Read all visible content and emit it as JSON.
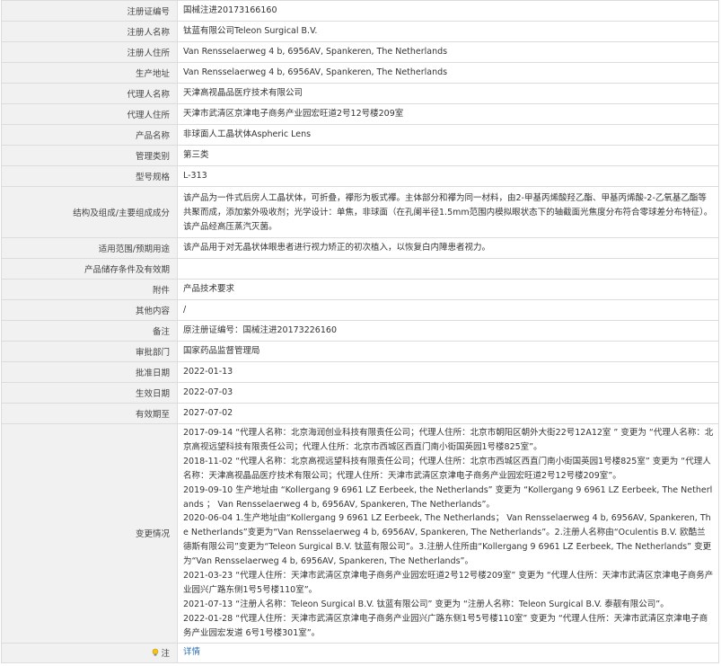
{
  "rows": [
    {
      "label": "注册证编号",
      "value": "国械注进20173166160"
    },
    {
      "label": "注册人名称",
      "value": "钛蓝有限公司Teleon Surgical B.V."
    },
    {
      "label": "注册人住所",
      "value": "Van Rensselaerweg 4 b, 6956AV, Spankeren, The Netherlands"
    },
    {
      "label": "生产地址",
      "value": "Van Rensselaerweg 4 b, 6956AV, Spankeren, The Netherlands"
    },
    {
      "label": "代理人名称",
      "value": "天津高视晶品医疗技术有限公司"
    },
    {
      "label": "代理人住所",
      "value": "天津市武清区京津电子商务产业园宏旺道2号12号楼209室"
    },
    {
      "label": "产品名称",
      "value": "非球面人工晶状体Aspheric Lens"
    },
    {
      "label": "管理类别",
      "value": "第三类"
    },
    {
      "label": "型号规格",
      "value": "L-313"
    },
    {
      "label": "结构及组成/主要组成成分",
      "value": "该产品为一件式后房人工晶状体，可折叠，襻形为板式襻。主体部分和襻为同一材料，由2-甲基丙烯酸羟乙酯、甲基丙烯酸-2-乙氧基乙酯等共聚而成，添加紫外吸收剂；光学设计：单焦，非球面（在孔阑半径1.5mm范围内模拟眼状态下的轴截面光焦度分布符合零球差分布特征）。该产品经高压蒸汽灭菌。"
    },
    {
      "label": "适用范围/预期用途",
      "value": "该产品用于对无晶状体眼患者进行视力矫正的初次植入，以恢复白内障患者视力。"
    },
    {
      "label": "产品储存条件及有效期",
      "value": ""
    },
    {
      "label": "附件",
      "value": "产品技术要求"
    },
    {
      "label": "其他内容",
      "value": "/"
    },
    {
      "label": "备注",
      "value": "原注册证编号：国械注进20173226160"
    },
    {
      "label": "审批部门",
      "value": "国家药品监督管理局"
    },
    {
      "label": "批准日期",
      "value": "2022-01-13"
    },
    {
      "label": "生效日期",
      "value": "2022-07-03"
    },
    {
      "label": "有效期至",
      "value": "2027-07-02"
    }
  ],
  "changes": {
    "label": "变更情况",
    "lines": [
      "2017-09-14 “代理人名称：北京海润创业科技有限责任公司；代理人住所：北京市朝阳区朝外大街22号12A12室 ” 变更为 “代理人名称：北京高视远望科技有限责任公司；代理人住所：北京市西城区西直门南小街国英园1号楼825室”。",
      "2018-11-02 “代理人名称：北京高视远望科技有限责任公司；代理人住所：北京市西城区西直门南小街国英园1号楼825室” 变更为 “代理人名称：天津高视晶品医疗技术有限公司；代理人住所：天津市武清区京津电子商务产业园宏旺道2号12号楼209室”。",
      "2019-09-10 生产地址由 “Kollergang 9 6961 LZ Eerbeek, the Netherlands” 变更为 “Kollergang 9 6961 LZ Eerbeek, The Netherlands ； Van Rensselaerweg 4 b, 6956AV, Spankeren, The Netherlands”。",
      "2020-06-04 1.生产地址由“Kollergang 9 6961 LZ Eerbeek, The Netherlands； Van Rensselaerweg 4 b, 6956AV, Spankeren, The Netherlands”变更为“Van Rensselaerweg 4 b, 6956AV, Spankeren, The Netherlands”。2.注册人名称由“Oculentis B.V. 欧酷兰德斯有限公司”变更为“Teleon Surgical B.V. 钛蓝有限公司”。3.注册人住所由“Kollergang 9 6961 LZ Eerbeek, The Netherlands” 变更为“Van Rensselaerweg 4 b, 6956AV, Spankeren, The Netherlands”。",
      "2021-03-23 “代理人住所：天津市武清区京津电子商务产业园宏旺道2号12号楼209室” 变更为 “代理人住所：天津市武清区京津电子商务产业园兴广路东侧1号5号楼110室”。",
      "2021-07-13 “注册人名称：Teleon Surgical B.V. 钛蓝有限公司” 变更为 “注册人名称：Teleon Surgical B.V. 泰靓有限公司”。",
      "2022-01-28 “代理人住所：天津市武清区京津电子商务产业园兴广路东侧1号5号楼110室” 变更为 “代理人住所：天津市武清区京津电子商务产业园宏发道 6号1号楼301室”。"
    ]
  },
  "note": {
    "label": "注",
    "icon": "tip-bulb-icon",
    "link_text": "详情"
  }
}
